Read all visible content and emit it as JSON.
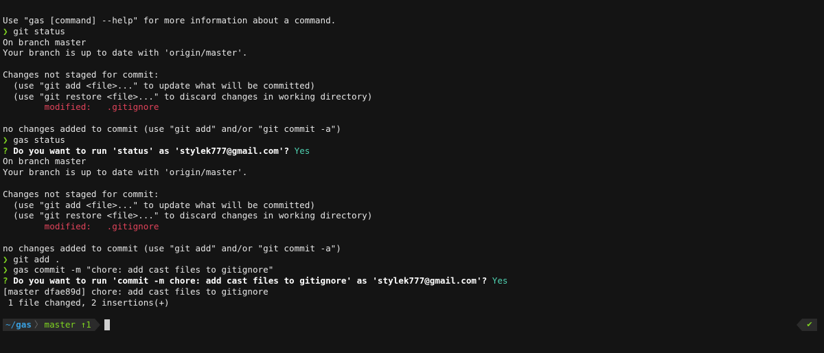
{
  "chevron": "❯",
  "question_mark": "?",
  "lines": {
    "help": "Use \"gas [command] --help\" for more information about a command.",
    "cmd1": "git status",
    "branch1": "On branch master",
    "uptodate1": "Your branch is up to date with 'origin/master'.",
    "notstaged1": "Changes not staged for commit:",
    "hint_add1": "  (use \"git add <file>...\" to update what will be committed)",
    "hint_restore1": "  (use \"git restore <file>...\" to discard changes in working directory)",
    "modified_label1": "        modified:   ",
    "modified_file1": ".gitignore",
    "nochanges1": "no changes added to commit (use \"git add\" and/or \"git commit -a\")",
    "cmd2": "gas status",
    "question1": "Do you want to run 'status' as 'stylek777@gmail.com'?",
    "answer1": "Yes",
    "branch2": "On branch master",
    "uptodate2": "Your branch is up to date with 'origin/master'.",
    "notstaged2": "Changes not staged for commit:",
    "hint_add2": "  (use \"git add <file>...\" to update what will be committed)",
    "hint_restore2": "  (use \"git restore <file>...\" to discard changes in working directory)",
    "modified_label2": "        modified:   ",
    "modified_file2": ".gitignore",
    "nochanges2": "no changes added to commit (use \"git add\" and/or \"git commit -a\")",
    "cmd3": "git add .",
    "cmd4": "gas commit -m \"chore: add cast files to gitignore\"",
    "question2": "Do you want to run 'commit -m chore: add cast files to gitignore' as 'stylek777@gmail.com'?",
    "answer2": "Yes",
    "commit_result": "[master dfae89d] chore: add cast files to gitignore",
    "commit_stats": " 1 file changed, 2 insertions(+)"
  },
  "prompt": {
    "dir_prefix": "~/",
    "dir_name": "gas",
    "branch": "master",
    "ahead": "↑1",
    "status_icon": "✔"
  },
  "colors": {
    "background": "#141414",
    "foreground": "#e5e5e5",
    "chevron": "#7ed321",
    "answer": "#4fd1b0",
    "modified": "#e0435a",
    "dir": "#39a0e0",
    "segment_bg": "#2b2b2b"
  }
}
